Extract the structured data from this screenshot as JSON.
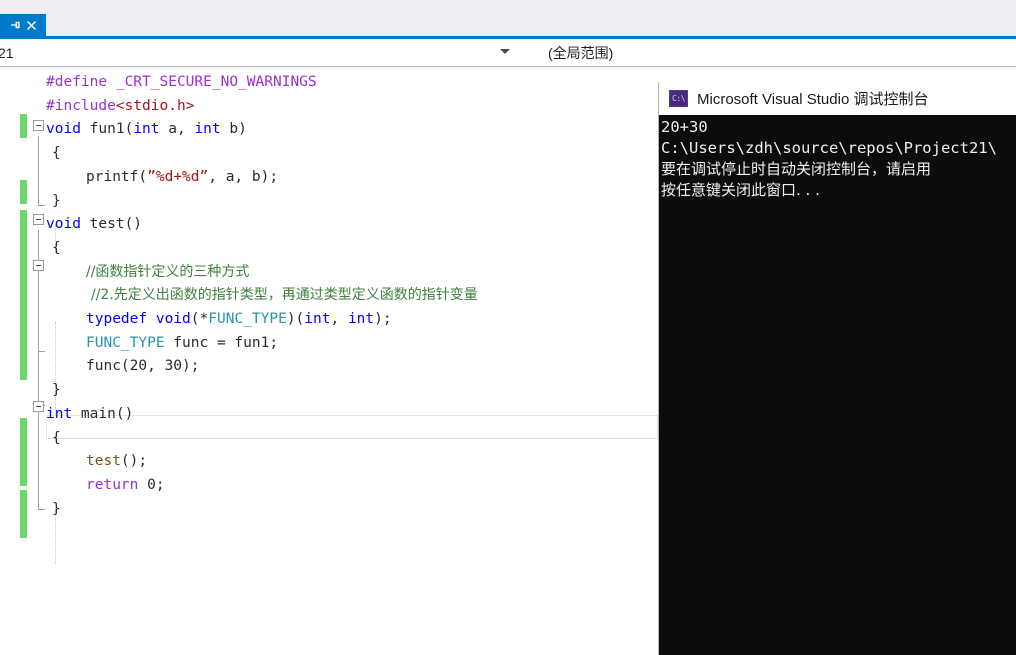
{
  "tab": {
    "pin_icon": "pin-icon",
    "close_icon": "close-icon"
  },
  "toolbar": {
    "member_dropdown_value": "21",
    "scope_dropdown_value": "(全局范围)",
    "dropdown_arrow_icon": "chevron-down-icon"
  },
  "editor": {
    "lines": [
      {
        "indent": 46,
        "segments": [
          {
            "t": "#define ",
            "c": "pre"
          },
          {
            "t": "_CRT_SECURE_NO_WARNINGS",
            "c": "pre"
          }
        ]
      },
      {
        "indent": 46,
        "segments": [
          {
            "t": "#include",
            "c": "pre"
          },
          {
            "t": "<stdio.h>",
            "c": "str"
          }
        ]
      },
      {
        "indent": 46,
        "segments": [
          {
            "t": "void ",
            "c": "kw"
          },
          {
            "t": "fun1",
            "c": "pl"
          },
          {
            "t": "(",
            "c": "pl"
          },
          {
            "t": "int ",
            "c": "kw"
          },
          {
            "t": "a, ",
            "c": "pl"
          },
          {
            "t": "int ",
            "c": "kw"
          },
          {
            "t": "b)",
            "c": "pl"
          }
        ]
      },
      {
        "indent": 52,
        "segments": [
          {
            "t": "{",
            "c": "pl"
          }
        ]
      },
      {
        "indent": 86,
        "segments": [
          {
            "t": "printf",
            "c": "pl"
          },
          {
            "t": "(",
            "c": "pl"
          },
          {
            "t": "”%d+%d”",
            "c": "str"
          },
          {
            "t": ", a, b);",
            "c": "pl"
          }
        ]
      },
      {
        "indent": 52,
        "segments": [
          {
            "t": "}",
            "c": "pl"
          }
        ]
      },
      {
        "indent": 46,
        "segments": [
          {
            "t": "void ",
            "c": "kw"
          },
          {
            "t": "test",
            "c": "pl"
          },
          {
            "t": "()",
            "c": "pl"
          }
        ]
      },
      {
        "indent": 52,
        "segments": [
          {
            "t": "{",
            "c": "pl"
          }
        ]
      },
      {
        "indent": 86,
        "segments": [
          {
            "t": "//函数指针定义的三种方式",
            "c": "cmt"
          }
        ]
      },
      {
        "indent": 91,
        "segments": [
          {
            "t": "//2.先定义出函数的指针类型，再通过类型定义函数的指针变量",
            "c": "cmt"
          }
        ]
      },
      {
        "indent": 86,
        "segments": [
          {
            "t": "typedef ",
            "c": "kw"
          },
          {
            "t": "void",
            "c": "kw"
          },
          {
            "t": "(*",
            "c": "pl"
          },
          {
            "t": "FUNC_TYPE",
            "c": "typ"
          },
          {
            "t": ")(",
            "c": "pl"
          },
          {
            "t": "int",
            "c": "kw"
          },
          {
            "t": ", ",
            "c": "pl"
          },
          {
            "t": "int",
            "c": "kw"
          },
          {
            "t": ");",
            "c": "pl"
          }
        ]
      },
      {
        "indent": 86,
        "segments": [
          {
            "t": "FUNC_TYPE",
            "c": "typ"
          },
          {
            "t": " func = fun1;",
            "c": "pl"
          }
        ]
      },
      {
        "indent": 86,
        "segments": [
          {
            "t": "func",
            "c": "pl"
          },
          {
            "t": "(",
            "c": "pl"
          },
          {
            "t": "20, 30",
            "c": "pl"
          },
          {
            "t": ");",
            "c": "pl"
          }
        ]
      },
      {
        "indent": 52,
        "segments": [
          {
            "t": "}",
            "c": "pl"
          }
        ]
      },
      {
        "indent": 46,
        "segments": [
          {
            "t": "int ",
            "c": "kw"
          },
          {
            "t": "main",
            "c": "pl"
          },
          {
            "t": "()",
            "c": "pl"
          }
        ]
      },
      {
        "indent": 52,
        "segments": [
          {
            "t": "{",
            "c": "pl"
          }
        ]
      },
      {
        "indent": 86,
        "segments": [
          {
            "t": "test",
            "c": "fn"
          },
          {
            "t": "();",
            "c": "pl"
          }
        ]
      },
      {
        "indent": 86,
        "segments": [
          {
            "t": "return ",
            "c": "pre"
          },
          {
            "t": "0;",
            "c": "pl"
          }
        ]
      },
      {
        "indent": 52,
        "segments": [
          {
            "t": "}",
            "c": "pl"
          }
        ]
      }
    ],
    "change_bar_color": "#6cd86c",
    "current_line_index": 12
  },
  "console": {
    "title": "Microsoft Visual Studio 调试控制台",
    "icon": "console-app-icon",
    "icon_glyph": "C:\\",
    "lines": [
      "20+30",
      "C:\\Users\\zdh\\source\\repos\\Project21\\",
      "要在调试停止时自动关闭控制台，请启用",
      "按任意键关闭此窗口. . ."
    ]
  }
}
